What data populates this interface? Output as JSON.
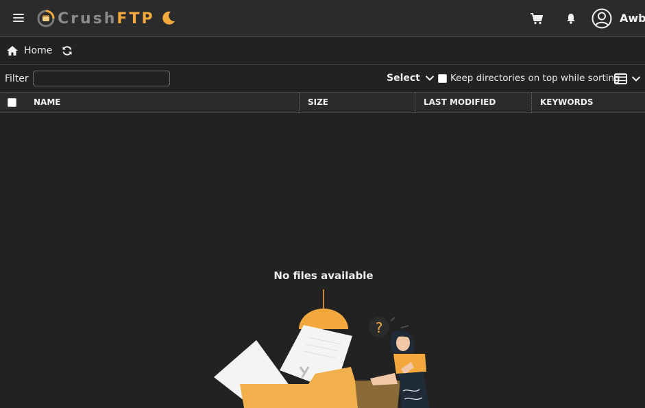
{
  "app": {
    "logo_text_part1": "Crush",
    "logo_text_part2": "FTP"
  },
  "header": {
    "username": "Awb"
  },
  "breadcrumb": {
    "home_label": "Home"
  },
  "filter": {
    "label": "Filter",
    "value": "",
    "placeholder": ""
  },
  "toolbar": {
    "select_label": "Select",
    "keep_dirs_label": "Keep directories on top while sorting",
    "keep_dirs_checked": false
  },
  "table": {
    "columns": [
      "NAME",
      "SIZE",
      "LAST MODIFIED",
      "KEYWORDS"
    ],
    "rows": []
  },
  "empty_state": {
    "message": "No files available",
    "illustration_question_mark": "?"
  },
  "colors": {
    "accent": "#f2a83d",
    "background": "#222222",
    "bar": "#2b2b2b"
  },
  "icons": [
    "menu-icon",
    "crushftp-logo-icon",
    "moon-icon",
    "cart-icon",
    "bell-icon",
    "user-circle-icon",
    "home-icon",
    "refresh-icon",
    "chevron-down-icon",
    "table-view-icon"
  ]
}
